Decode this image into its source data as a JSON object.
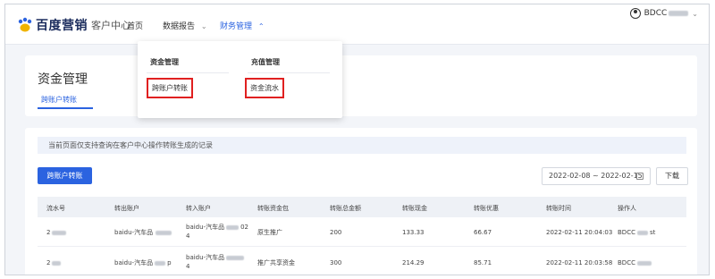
{
  "header": {
    "logo_brand": "百度营销",
    "logo_sub": "客户中心",
    "nav": [
      {
        "label": "首页"
      },
      {
        "label": "数据报告"
      },
      {
        "label": "财务管理"
      }
    ],
    "user": "BDCC"
  },
  "dropdown": {
    "col1_title": "资金管理",
    "col1_link": "跨账户转账",
    "col2_title": "充值管理",
    "col2_link": "资金流水"
  },
  "page": {
    "title": "资金管理",
    "tab": "跨账户转账",
    "notice": "当前页面仅支持查询在客户中心操作转账生成的记录",
    "transfer_button": "跨账户转账",
    "date_range": "2022-02-08 ~ 2022-02-15",
    "download_button": "下载"
  },
  "table": {
    "columns": [
      "流水号",
      "转出账户",
      "转入账户",
      "转账资金包",
      "转账总金额",
      "转账现金",
      "转账优惠",
      "转账时间",
      "操作人"
    ],
    "rows": [
      {
        "serial": "2",
        "from_account": "baidu-汽车品",
        "to_account_line1": "baidu-汽车品",
        "to_account_suffix": "02",
        "to_account_line2": "4",
        "fund_package": "原生推广",
        "total": "200",
        "cash": "133.33",
        "discount": "66.67",
        "time": "2022-02-11 20:04:03",
        "operator": "BDCC",
        "operator_suffix": "st"
      },
      {
        "serial": "2",
        "from_account": "baidu-汽车品",
        "from_suffix": "p",
        "to_account_line1": "baidu-汽车品",
        "to_account_suffix": "",
        "to_account_line2": "4",
        "fund_package": "推广共享资金",
        "total": "300",
        "cash": "214.29",
        "discount": "85.71",
        "time": "2022-02-11 20:03:58",
        "operator": "BDCC",
        "operator_suffix": ""
      }
    ]
  },
  "colors": {
    "accent": "#2b63e0",
    "highlight_box": "#e02020"
  },
  "icons": [
    "baidu-paw-logo-icon",
    "chevron-down-icon",
    "chevron-up-icon",
    "user-icon",
    "calendar-icon"
  ]
}
